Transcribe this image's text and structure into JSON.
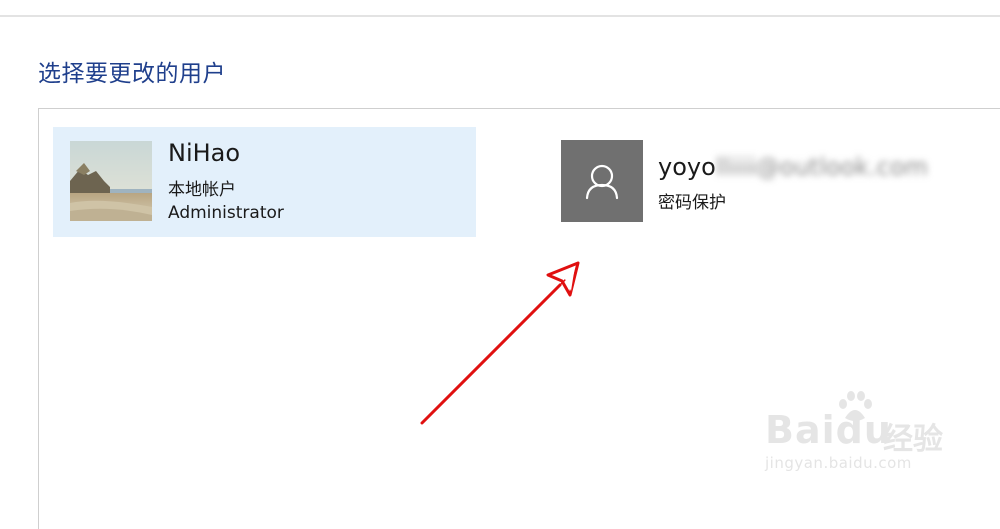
{
  "page": {
    "title": "选择要更改的用户"
  },
  "users": [
    {
      "name": "NiHao",
      "account_type": "本地帐户",
      "role": "Administrator",
      "selected": true,
      "avatar": "landscape-photo"
    },
    {
      "name_visible": "yoyo",
      "name_blurred": "lliiii@outlook.com",
      "protection": "密码保护",
      "selected": false,
      "avatar": "user-silhouette-icon"
    }
  ],
  "watermark": {
    "logo": "Baidu",
    "label": "经验",
    "url": "jingyan.baidu.com"
  },
  "colors": {
    "title": "#1f3f8c",
    "selected_tile": "#e3f0fb",
    "generic_avatar": "#707070",
    "annotation_arrow": "#e01010"
  }
}
